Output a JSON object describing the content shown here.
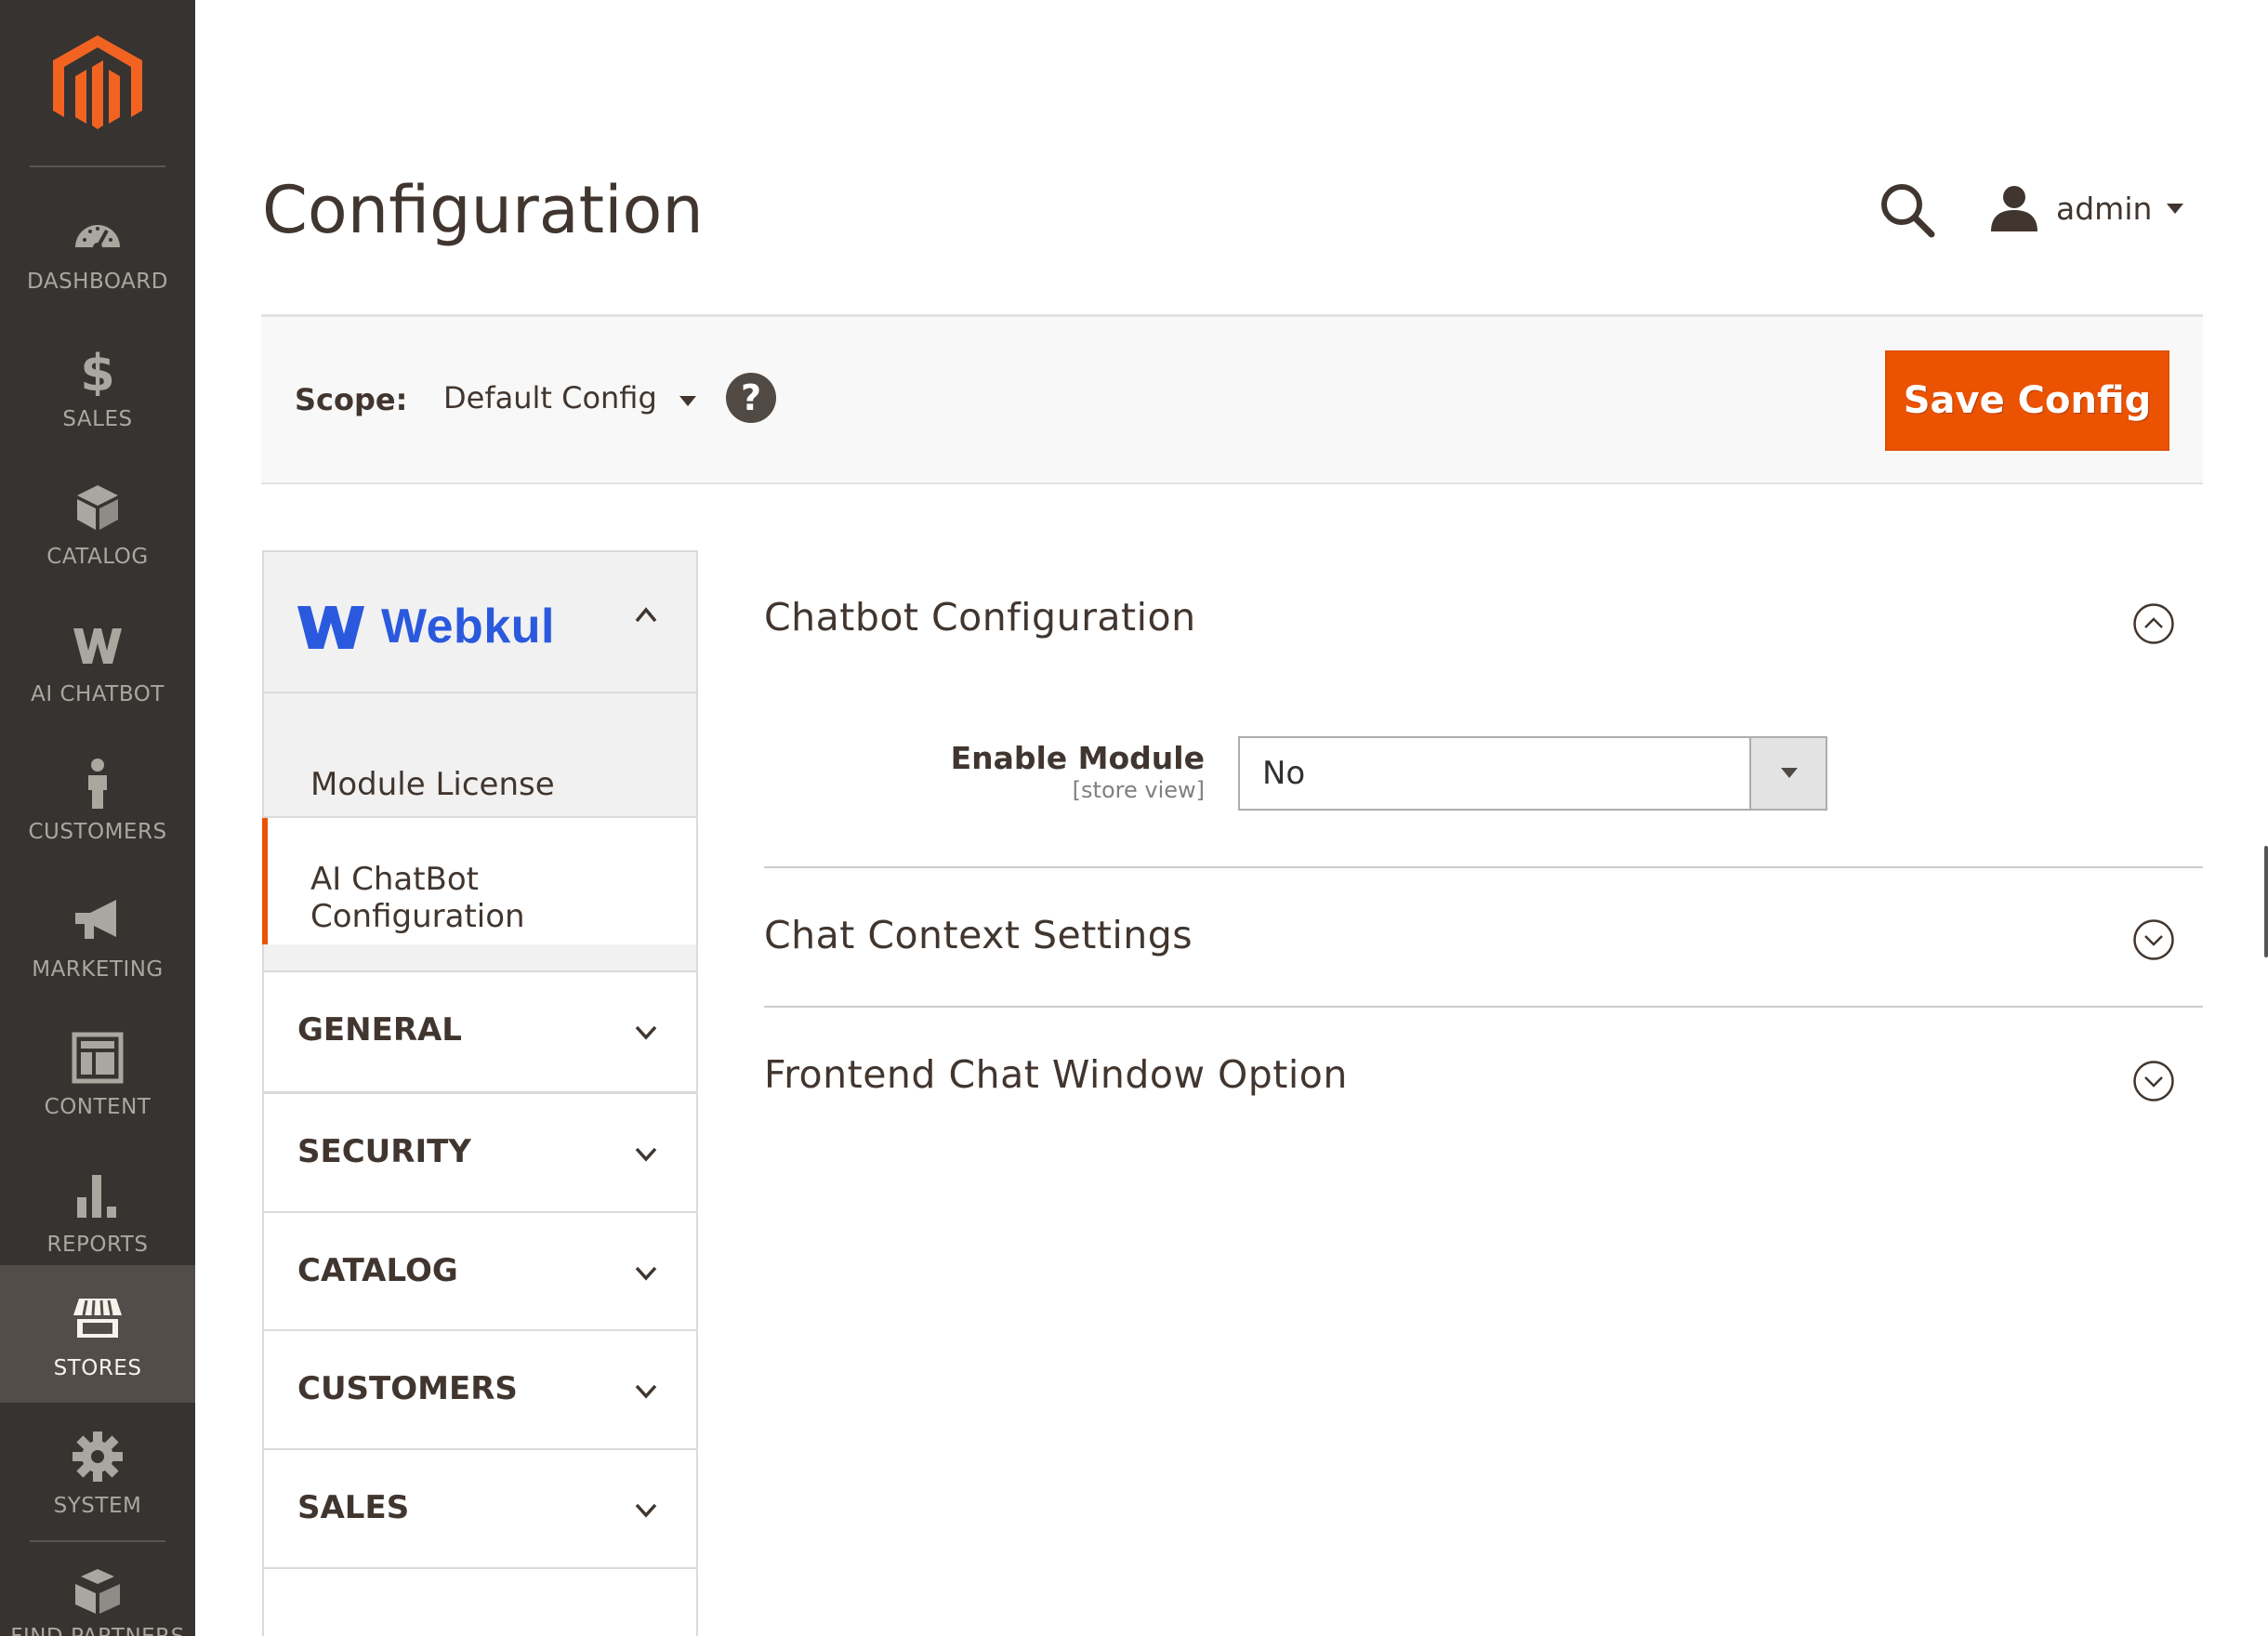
{
  "nav": {
    "items": [
      {
        "label": "DASHBOARD",
        "icon": "dashboard-icon"
      },
      {
        "label": "SALES",
        "icon": "dollar-icon"
      },
      {
        "label": "CATALOG",
        "icon": "cube-icon"
      },
      {
        "label": "AI CHATBOT",
        "icon": "webkul-w-icon"
      },
      {
        "label": "CUSTOMERS",
        "icon": "person-icon"
      },
      {
        "label": "MARKETING",
        "icon": "megaphone-icon"
      },
      {
        "label": "CONTENT",
        "icon": "layout-icon"
      },
      {
        "label": "REPORTS",
        "icon": "bar-chart-icon"
      },
      {
        "label": "STORES",
        "icon": "store-icon"
      },
      {
        "label": "SYSTEM",
        "icon": "gear-icon"
      },
      {
        "label": "FIND PARTNERS",
        "icon": "boxes-icon"
      }
    ],
    "active": "STORES",
    "colors": {
      "background": "#373330",
      "active": "#524d49",
      "accent": "#eb5202"
    }
  },
  "header": {
    "title": "Configuration",
    "user": "admin"
  },
  "scope": {
    "label": "Scope:",
    "value": "Default Config",
    "help": "?",
    "save_label": "Save Config"
  },
  "tabs": {
    "vendor": "Webkul",
    "sub_items": [
      "Module License",
      "AI ChatBot Configuration"
    ],
    "active_sub": "AI ChatBot Configuration",
    "sections": [
      "GENERAL",
      "SECURITY",
      "CATALOG",
      "CUSTOMERS",
      "SALES"
    ]
  },
  "main": {
    "sections": [
      {
        "title": "Chatbot Configuration",
        "expanded": true
      },
      {
        "title": "Chat Context Settings",
        "expanded": false
      },
      {
        "title": "Frontend Chat Window Option",
        "expanded": false
      }
    ],
    "enable_module": {
      "label": "Enable Module",
      "scope": "[store view]",
      "value": "No"
    }
  }
}
